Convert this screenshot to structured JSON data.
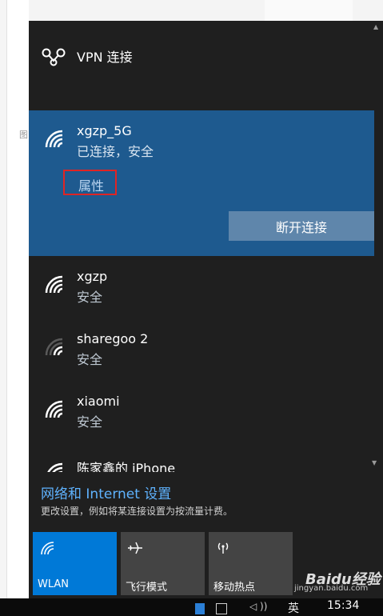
{
  "background": {
    "left_char": "图"
  },
  "vpn": {
    "label": "VPN 连接",
    "icon": "vpn-icon"
  },
  "networks": {
    "selected": {
      "name": "xgzp_5G",
      "status": "已连接，安全",
      "properties_label": "属性",
      "disconnect_label": "断开连接"
    },
    "list": [
      {
        "name": "xgzp",
        "status": "安全",
        "signal": "strong"
      },
      {
        "name": "sharegoo 2",
        "status": "安全",
        "signal": "weak"
      },
      {
        "name": "xiaomi",
        "status": "安全",
        "signal": "strong"
      },
      {
        "name": "陈家鑫的 iPhone",
        "signal": "strong"
      }
    ]
  },
  "settings": {
    "link": "网络和 Internet 设置",
    "description": "更改设置，例如将某连接设置为按流量计费。"
  },
  "quick_actions": [
    {
      "label": "WLAN",
      "icon": "wifi-icon",
      "active": true
    },
    {
      "label": "飞行模式",
      "icon": "airplane-icon",
      "active": false
    },
    {
      "label": "移动热点",
      "icon": "hotspot-icon",
      "active": false
    }
  ],
  "taskbar": {
    "ime": "英",
    "time": "15:34"
  },
  "watermark": {
    "logo": "Baidu经验",
    "url": "jingyan.baidu.com"
  },
  "colors": {
    "flyout_bg": "#1f1f1f",
    "selected_bg": "#1e5a8f",
    "accent": "#0079d7",
    "link": "#5fb3ff",
    "highlight_box": "#e02424"
  }
}
